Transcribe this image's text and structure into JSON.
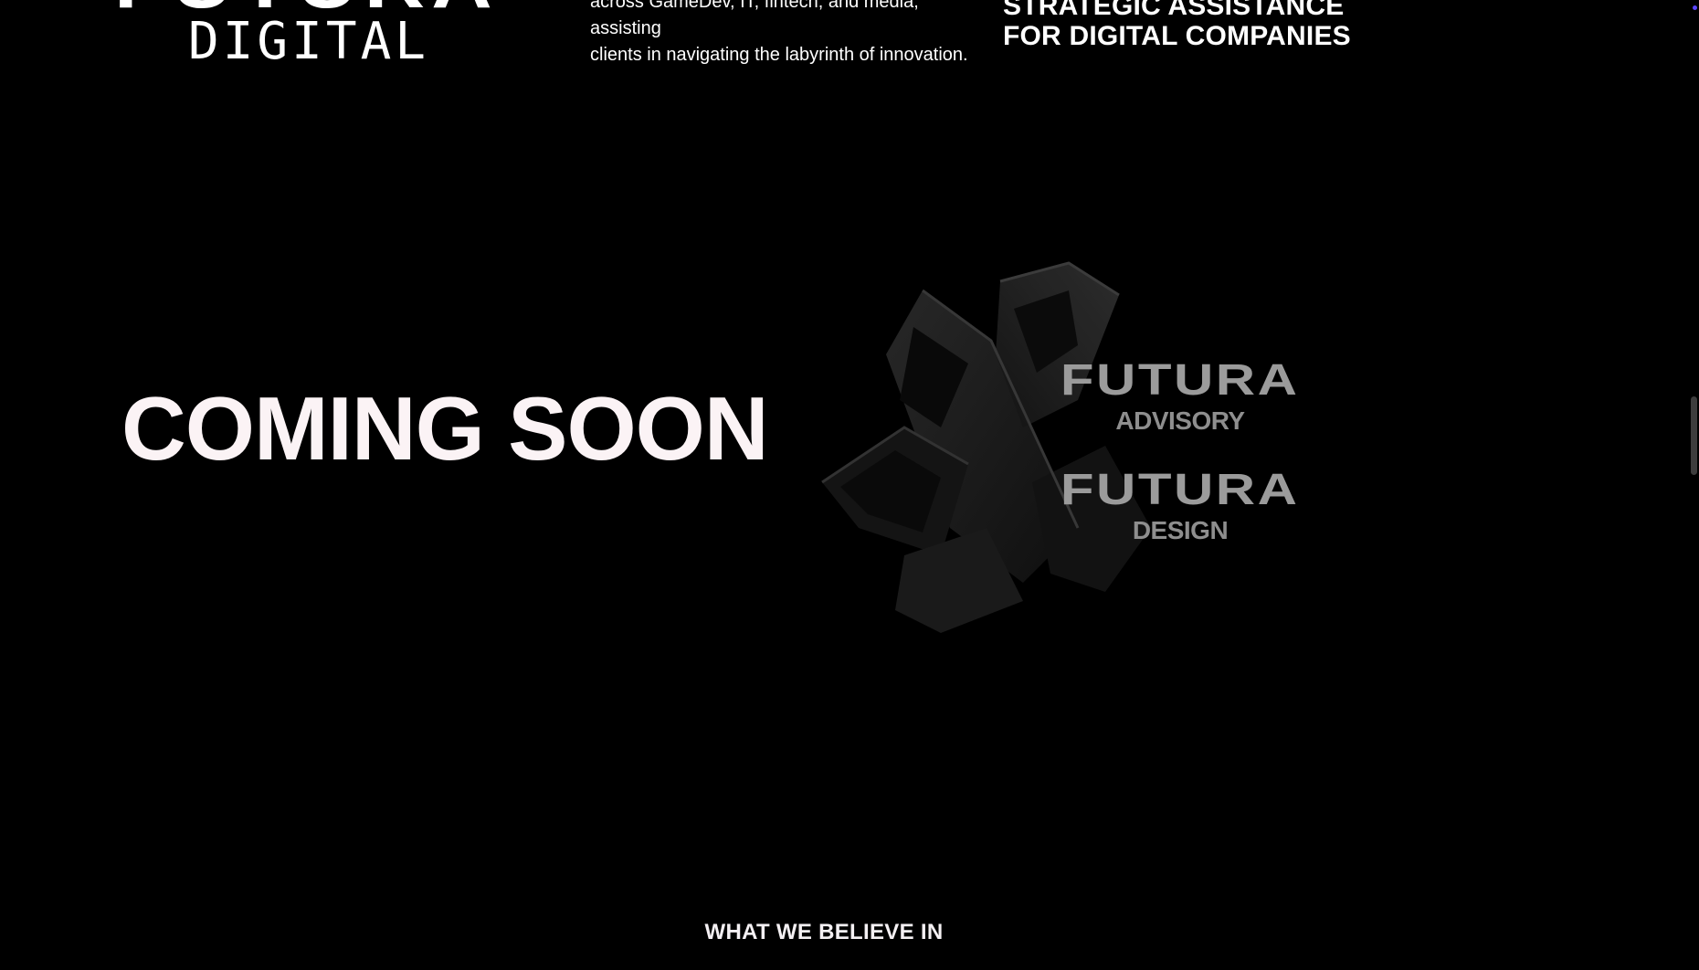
{
  "header": {
    "logo_main": "FUTURA",
    "logo_sub": "DIGITAL",
    "intro_line1": "across GameDev, IT, fintech, and media, assisting",
    "intro_line2": "clients in navigating the labyrinth of innovation.",
    "tagline_line1": "STRATEGIC ASSISTANCE",
    "tagline_line2": "FOR DIGITAL COMPANIES"
  },
  "hero": {
    "heading": "COMING SOON"
  },
  "brands": [
    {
      "name": "FUTURA",
      "sub": "ADVISORY"
    },
    {
      "name": "FUTURA",
      "sub": "DESIGN"
    }
  ],
  "section": {
    "believe_title": "WHAT WE BELIEVE IN"
  },
  "colors": {
    "background": "#000000",
    "text": "#ffffff",
    "brand_gray": "#9b9b9b",
    "scroll_accent": "#5b46ff"
  }
}
